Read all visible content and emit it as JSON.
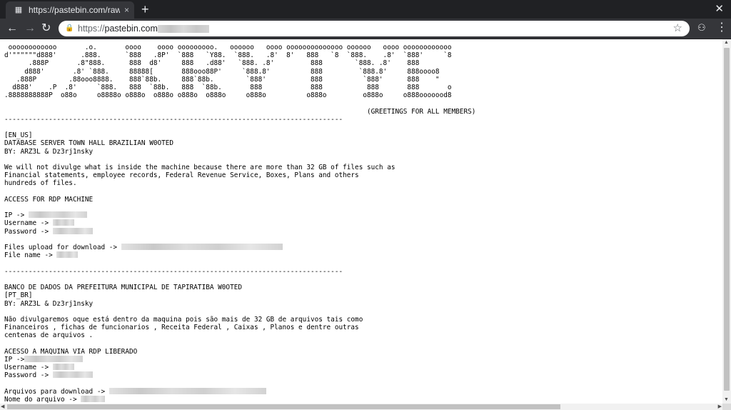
{
  "browser": {
    "tab_title": "https://pastebin.com/raw/l",
    "tab_close": "×",
    "new_tab": "+",
    "window_close": "✕",
    "back": "←",
    "forward": "→",
    "reload": "↻",
    "url_protocol": "https://",
    "url_host": "pastebin.com",
    "star": "☆",
    "menu": "⋮"
  },
  "content": {
    "ascii_art": " oooooooooooo       .o.       oooo    oooo ooooooooo.   oooooo   oooo oooooooooooooo oooooo   oooo oooooooooooo\nd'\"\"\"\"\"\"d888'      .888.      `888   .8P'  `888   `Y88.  `888.   .8'  8'   888   `8  `888.    .8'  `888'     `8\n      .888P       .8\"888.      888  d8'     888   .d88'   `888. .8'         888        `888. .8'    888\n     d888'       .8' `888.     88888[       888ooo88P'     `888.8'          888         `888.8'     888oooo8\n   .888P        .88ooo8888.    888`88b.     888`88b.        `888'           888          `888'      888    \"\n  d888'    .P  .8'     `888.   888  `88b.   888  `88b.       888            888           888       888       o\n.8888888888P  o88o     o8888o o888o  o888o o888o  o888o     o888o          o888o         o888o     o888ooooood8\n\n                                                                                          (GREETINGS FOR ALL MEMBERS)",
    "separator": "------------------------------------------------------------------------------------",
    "en": {
      "lang_tag": "[EN_US]",
      "title": "DATABASE SERVER TOWN HALL BRAZILIAN W0OTED",
      "by": "BY: ARZ3L & Dz3rj1nsky",
      "body": "We will not divulge what is inside the machine because there are more than 32 GB of files such as\nFinancial statements, employee records, Federal Revenue Service, Boxes, Plans and others\nhundreds of files.",
      "access_heading": "ACCESS FOR RDP MACHINE",
      "ip_label": "IP -> ",
      "username_label": "Username -> ",
      "password_label": "Password -> ",
      "files_label": "Files upload for download -> ",
      "filename_label": "File name -> "
    },
    "pt": {
      "title": "BANCO DE DADOS DA PREFEITURA MUNICIPAL DE TAPIRATIBA W0OTED",
      "lang_tag": "[PT_BR]",
      "by": "BY: ARZ3L & Dz3rj1nsky",
      "body": "Não divulgaremos oque está dentro da maquina pois são mais de 32 GB de arquivos tais como\nFinanceiros , fichas de funcionarios , Receita Federal , Caixas , Planos e dentre outras\ncentenas de arquivos .",
      "access_heading": "ACESSO A MAQUINA VIA RDP LIBERADO",
      "ip_label": "IP ->",
      "username_label": "Username -> ",
      "password_label": "Password -> ",
      "files_label": "Arquivos para download -> ",
      "filename_label": "Nome do arquivo -> "
    }
  }
}
